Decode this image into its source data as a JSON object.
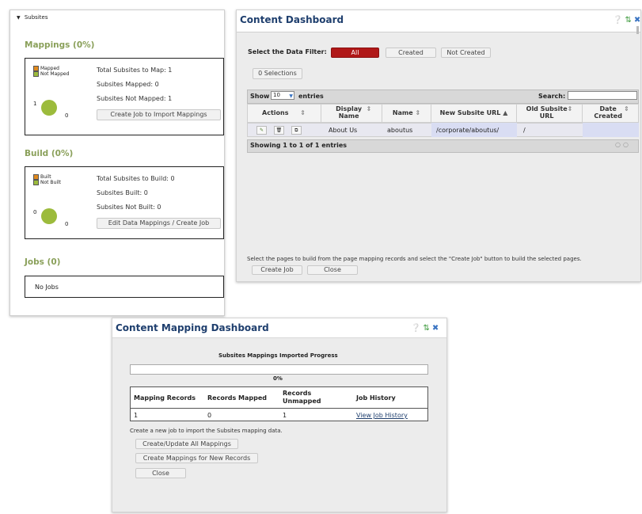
{
  "subsites": {
    "header_label": "Subsites",
    "mappings": {
      "title": "Mappings (0%)",
      "legend": [
        "Mapped",
        "Not Mapped"
      ],
      "chart_labels": [
        "1",
        "0"
      ],
      "total_label": "Total Subsites to Map: 1",
      "mapped_label": "Subsites Mapped: 0",
      "not_mapped_label": "Subsites Not Mapped: 1",
      "button_label": "Create Job to Import Mappings"
    },
    "build": {
      "title": "Build (0%)",
      "legend": [
        "Built",
        "Not Built"
      ],
      "chart_labels": [
        "0",
        "0"
      ],
      "total_label": "Total Subsites to Build: 0",
      "built_label": "Subsites Built: 0",
      "not_built_label": "Subsites Not Built: 0",
      "button_label": "Edit Data Mappings / Create Job"
    },
    "jobs": {
      "title": "Jobs (0)",
      "empty_label": "No Jobs"
    },
    "colors": {
      "orange": "#e08a1e",
      "green": "#9cbb3c"
    }
  },
  "content_dashboard": {
    "title": "Content Dashboard",
    "filter_label": "Select the Data Filter:",
    "filters": [
      "All",
      "Created",
      "Not Created"
    ],
    "active_filter": "All",
    "selections_label": "0 Selections",
    "show_label": "Show",
    "entries_count": "10",
    "entries_label": "entries",
    "search_label": "Search:",
    "columns": [
      "Actions",
      "Display Name",
      "Name",
      "New Subsite URL",
      "Old Subsite URL",
      "Date Created"
    ],
    "rows": [
      {
        "display_name": "About Us",
        "name": "aboutus",
        "new_url": "/corporate/aboutus/",
        "old_url": "/",
        "date_created": ""
      }
    ],
    "showing_label": "Showing 1 to 1 of 1 entries",
    "instructions": "Select the pages to build from the page mapping records and select the \"Create Job\" button to build the selected pages.",
    "create_job_label": "Create Job",
    "close_label": "Close",
    "colors": {
      "accent_red": "#b01818",
      "title_blue": "#1f3f6e",
      "row_highlight": "#d9ddf3"
    }
  },
  "mapping_dashboard": {
    "title": "Content Mapping Dashboard",
    "progress_title": "Subsites Mappings Imported Progress",
    "progress_value": 0,
    "progress_label": "0%",
    "columns": [
      "Mapping Records",
      "Records Mapped",
      "Records Unmapped",
      "Job History"
    ],
    "row": {
      "mapping_records": "1",
      "records_mapped": "0",
      "records_unmapped": "1",
      "job_history": "View Job History"
    },
    "instructions": "Create a new job to import the Subsites mapping data.",
    "buttons": [
      "Create/Update All Mappings",
      "Create Mappings for New Records",
      "Close"
    ]
  }
}
